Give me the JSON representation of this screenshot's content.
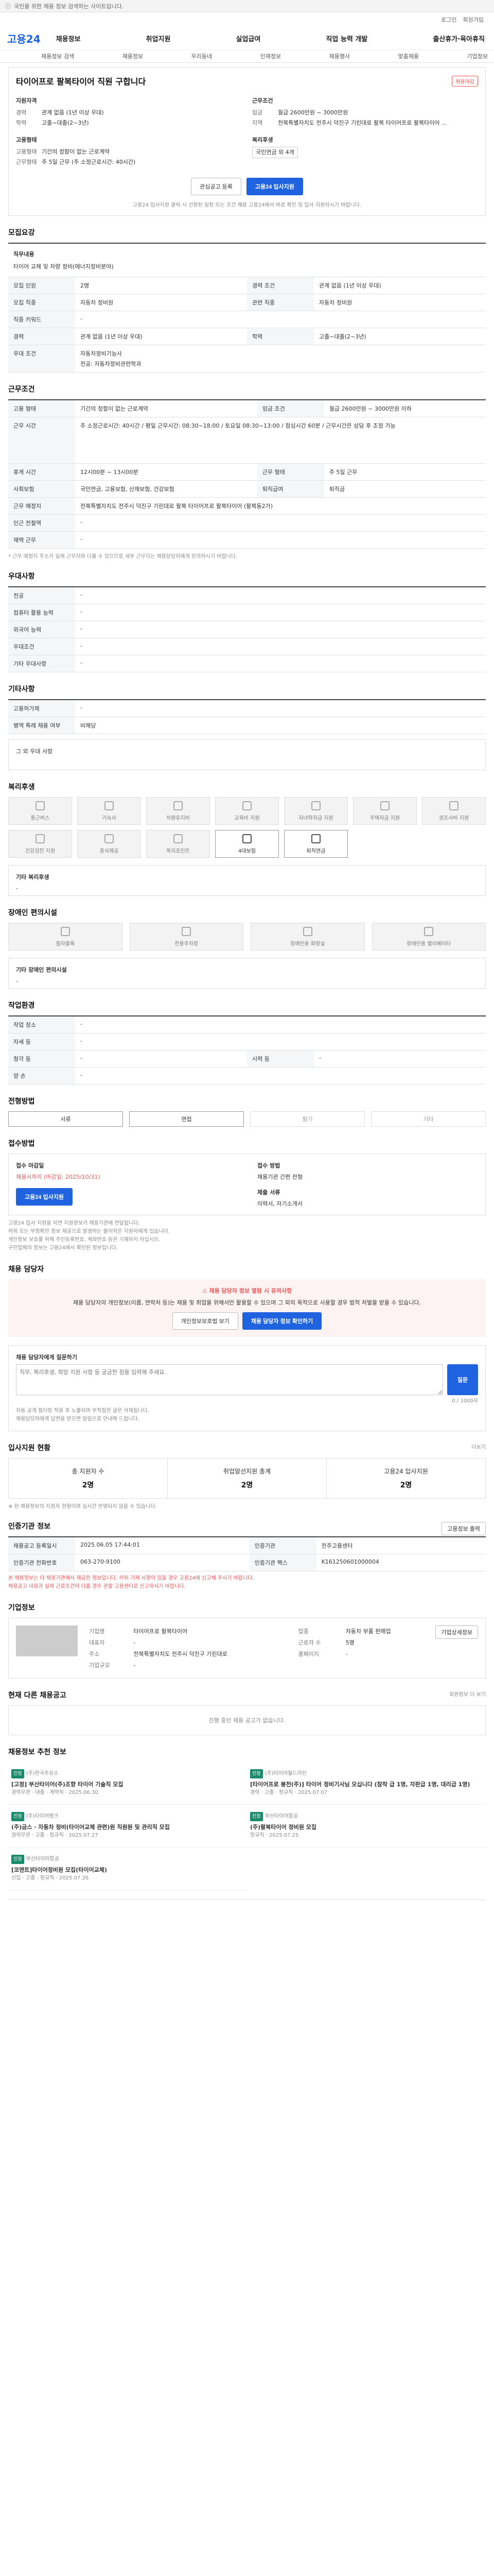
{
  "topbar": {
    "text": "국민을 위한 채용 정보 검색하는 사이트입니다."
  },
  "util": {
    "login": "로그인",
    "join": "회원가입"
  },
  "header": {
    "logo": "고용24",
    "nav": [
      "채용정보",
      "취업지원",
      "실업급여",
      "직업 능력 개발",
      "출산휴가·육아휴직"
    ]
  },
  "subnav": [
    "채용정보 검색",
    "채용정보",
    "우리동네",
    "인재정보",
    "채용행사",
    "맞춤채용",
    "기업정보"
  ],
  "job": {
    "title": "타이어프로 팔복타이어 직원 구합니다",
    "badge": "채용마감",
    "summary_left_title": "지원자격",
    "summary_right_title": "근무조건",
    "left": [
      {
        "k": "경력",
        "v": "관계 없음 (1년 이상 우대)"
      },
      {
        "k": "학력",
        "v": "고졸~대졸(2~3년)"
      }
    ],
    "left2_title": "고용형태",
    "left2": [
      {
        "k": "고용형태",
        "v": "기간의 정함이 없는 근로계약"
      },
      {
        "k": "근무형태",
        "v": "주 5일 근무 (주 소정근로시간: 40시간)"
      }
    ],
    "right": [
      {
        "k": "임금",
        "v": "월급 2600만원 ~ 3000만원"
      },
      {
        "k": "지역",
        "v": "전북특별자치도 전주시 덕진구 기린대로 팔복 타이어프로 팔복타이어 ..."
      }
    ],
    "right2_title": "복리후생",
    "right2": "국민연금 외 4개",
    "btn_save": "관심공고 등록",
    "btn_apply": "고용24 입사지원",
    "note": "고용24 입사지원 클릭 시 선정된 일정 또는 조건 채용 고용24에서 바로 확인 및 입사 지원하시기 바랍니다."
  },
  "recruit": {
    "title": "모집요강",
    "duty_label": "직무내용",
    "duty": "타이어 교체 및 차량 정비(에너지정비분야)",
    "rows": [
      [
        "모집 인원",
        "2명",
        "경력 조건",
        "관계 없음 (1년 이상 우대)"
      ],
      [
        "모집 직종",
        "자동차 정비원",
        "관련 직종",
        "자동차 정비원"
      ],
      [
        "직종 키워드",
        "-",
        "",
        ""
      ],
      [
        "경력",
        "관계 없음 (1년 이상 우대)",
        "학력",
        "고졸~대졸(2~3년)"
      ],
      [
        "우대 조건",
        "자동차정비기능사",
        "",
        ""
      ]
    ],
    "extra": "전공: 자동차정비관련학과"
  },
  "work": {
    "title": "근무조건",
    "rows": [
      [
        "고용 형태",
        "기간의 정함이 없는 근로계약",
        "임금 조건",
        "월급 2600만원 ~ 3000만원 이하"
      ],
      [
        "근무 시간",
        "주 소정근로시간: 40시간 / 평일 근무시간: 08:30~18:00 / 토요일 08:30~13:00 / 점심시간 60분 / 근무시간은 상담 후 조정 가능",
        "",
        ""
      ],
      [
        "휴게 시간",
        "12시00분 ~ 13시00분",
        "근무 형태",
        "주 5일 근무"
      ],
      [
        "사회보험",
        "국민연금, 고용보험, 산재보험, 건강보험",
        "퇴직급여",
        "퇴직금"
      ],
      [
        "근무 예정지",
        "전북특별자치도 전주시 덕진구 기린대로 팔복 타이어프로 팔복타이어 (팔복동2가)",
        "",
        ""
      ],
      [
        "인근 전철역",
        "-",
        "",
        ""
      ],
      [
        "재택 근무",
        "-",
        "",
        ""
      ]
    ],
    "note": "* 근무 예정지 주소가 실제 근무지와 다를 수 있으므로 세부 근무지는 채용담당자에게 문의하시기 바랍니다."
  },
  "preferred": {
    "title": "우대사항",
    "rows": [
      [
        "전공",
        "-"
      ],
      [
        "컴퓨터 활용 능력",
        "-"
      ],
      [
        "외국어 능력",
        "-"
      ],
      [
        "우대조건",
        "-"
      ],
      [
        "기타 우대사항",
        "-"
      ]
    ]
  },
  "etc": {
    "title": "기타사항",
    "rows": [
      [
        "고용허가제",
        "-"
      ],
      [
        "병역 특례 채용 여부",
        "비해당"
      ]
    ],
    "box": "그 외 우대 사항"
  },
  "welfare": {
    "title": "복리후생",
    "items": [
      "통근버스",
      "기숙사",
      "차량유지비",
      "교육비 지원",
      "자녀학자금 지원",
      "주택자금 지원",
      "경조사비 지원",
      "건강검진 지원",
      "중식제공",
      "복지포인트",
      "4대보험",
      "퇴직연금"
    ],
    "box_title": "기타 복리후생",
    "box": "-"
  },
  "disability": {
    "title": "장애인 편의시설",
    "items": [
      "점자블록",
      "전용주차장",
      "장애인용 화장실",
      "장애인용 엘리베이터"
    ],
    "box_title": "기타 장애인 편의시설",
    "box": "-"
  },
  "place": {
    "title": "작업환경",
    "rows": [
      [
        "작업 장소",
        "-",
        "",
        ""
      ],
      [
        "자세 등",
        "-",
        "",
        ""
      ],
      [
        "청각 등",
        "-",
        "시력 등",
        "-"
      ],
      [
        "양 손",
        "-",
        "",
        ""
      ]
    ]
  },
  "method": {
    "title": "전형방법",
    "items": [
      "서류",
      "면접",
      "필기",
      "기타"
    ]
  },
  "apply": {
    "title": "접수방법",
    "left_title": "접수 마감일",
    "deadline": "채용시까지 (마감일: 2025/10/31)",
    "right_title": "접수 방법",
    "right": "채용기관 간편 전형",
    "docs_title": "제출 서류",
    "docs": "이력서, 자기소개서",
    "btn": "고용24 입사지원",
    "notes": [
      "고용24 입사 지원을 하면 지원정보가 채용기관에 전달됩니다.",
      "허위 또는 부정확한 정보 제공으로 발생하는 불이익은 지원자에게 있습니다.",
      "개인정보 보호를 위해 주민등록번호, 계좌번호 등은 기재하지 마십시오.",
      "구인업체의 정보는 고용24에서 확인된 정보입니다."
    ]
  },
  "contact": {
    "title": "채용 담당자",
    "notice": "채용 담당자 정보 열람 시 유의사항",
    "body": "채용 담당자의 개인정보(이름, 연락처 등)는 채용 및 취업을 위해서만 활용할 수 있으며 그 외의 목적으로 사용할 경우 법적 처벌을 받을 수 있습니다.",
    "btn1": "개인정보보호법 보기",
    "btn2": "채용 담당자 정보 확인하기",
    "q_label": "채용 담당자에게 질문하기",
    "q_placeholder": "직무, 복리후생, 희망 지원 사항 등 궁금한 점을 입력해 주세요.",
    "q_count": "0 / 1000자",
    "q_btn": "질문",
    "q_notes": [
      "자동 공개 필터링 적용 후 노출되며 부적절한 글은 삭제됩니다.",
      "채용담당자에게 답변을 받으면 알림으로 안내해 드립니다."
    ]
  },
  "status": {
    "title": "입사지원 현황",
    "link": "더보기",
    "items": [
      {
        "label": "총 지원자 수",
        "n": "2명"
      },
      {
        "label": "취업알선지원 총계",
        "n": "2명"
      },
      {
        "label": "고용24 입사지원",
        "n": "2명"
      }
    ],
    "note": "※ 현 채용정보의 지원자 현황이며 실시간 반영되지 않을 수 있습니다."
  },
  "meta": {
    "title": "인증기관 정보",
    "btn": "고용정보 출력",
    "rows": [
      [
        "채용공고 등록일시",
        "2025.06.05 17:44:01",
        "인증기관",
        "전주고용센터"
      ],
      [
        "인증기관 전화번호",
        "063-270-9100",
        "인증기관 팩스",
        "K161250601000004"
      ]
    ],
    "notes": [
      "본 채용정보는 타 채용기관에서 제공한 정보입니다. 허위 기재 사항이 있을 경우 고용24에 신고해 주시기 바랍니다.",
      "채용공고 내용과 실제 근로조건이 다를 경우 관할 고용센터로 신고하시기 바랍니다."
    ]
  },
  "company": {
    "title": "기업정보",
    "btn": "기업상세정보",
    "rows": [
      [
        "기업명",
        "타이어프로 팔복타이어",
        "업종",
        "자동차 부품 판매업"
      ],
      [
        "대표자",
        "-",
        "근로자 수",
        "5명"
      ],
      [
        "주소",
        "전북특별자치도 전주시 덕진구 기린대로",
        "홈페이지",
        "-"
      ],
      [
        "기업규모",
        "-",
        "",
        ""
      ]
    ]
  },
  "other": {
    "title": "현재 다른 채용공고",
    "link": "회원정보 더 보기",
    "empty": "진행 중인 채용 공고가 없습니다."
  },
  "recommend": {
    "title": "채용정보 추천 정보",
    "items": [
      {
        "tag": "진정",
        "co": "(주)한국주유소",
        "t": "[고정] 부산타이어(주)조향 타이어 기술직 모집",
        "meta": "경력무관 · 대졸 · 계약직 · 2025.06.30"
      },
      {
        "tag": "진정",
        "co": "(주)타이어월드라인",
        "t": "[타이어프로 봉천(주)] 타이어 정비기사님 모십니다 (참착 급 1명, 자판급 1명, 대리급 1명)",
        "meta": "경력 · 고졸 · 정규직 · 2025.07.07"
      },
      {
        "tag": "진정",
        "co": "(주)타이어뱅크",
        "t": "(주)금스 · 자동차 정비(타이어교체 관련)원 직원원 및 관리직 모집",
        "meta": "경력무관 · 고졸 · 정규직 · 2025.07.27"
      },
      {
        "tag": "진정",
        "co": "부산타이어합공",
        "t": "(주)팔복타이어 정비원 모집",
        "meta": "정규직 · 2025.07.25"
      },
      {
        "tag": "진정",
        "co": "부산타이어합공",
        "t": "[코맨트]타이어정비원 모집(타이어교체)",
        "meta": "신입 · 고졸 · 정규직 · 2025.07.26"
      }
    ]
  }
}
